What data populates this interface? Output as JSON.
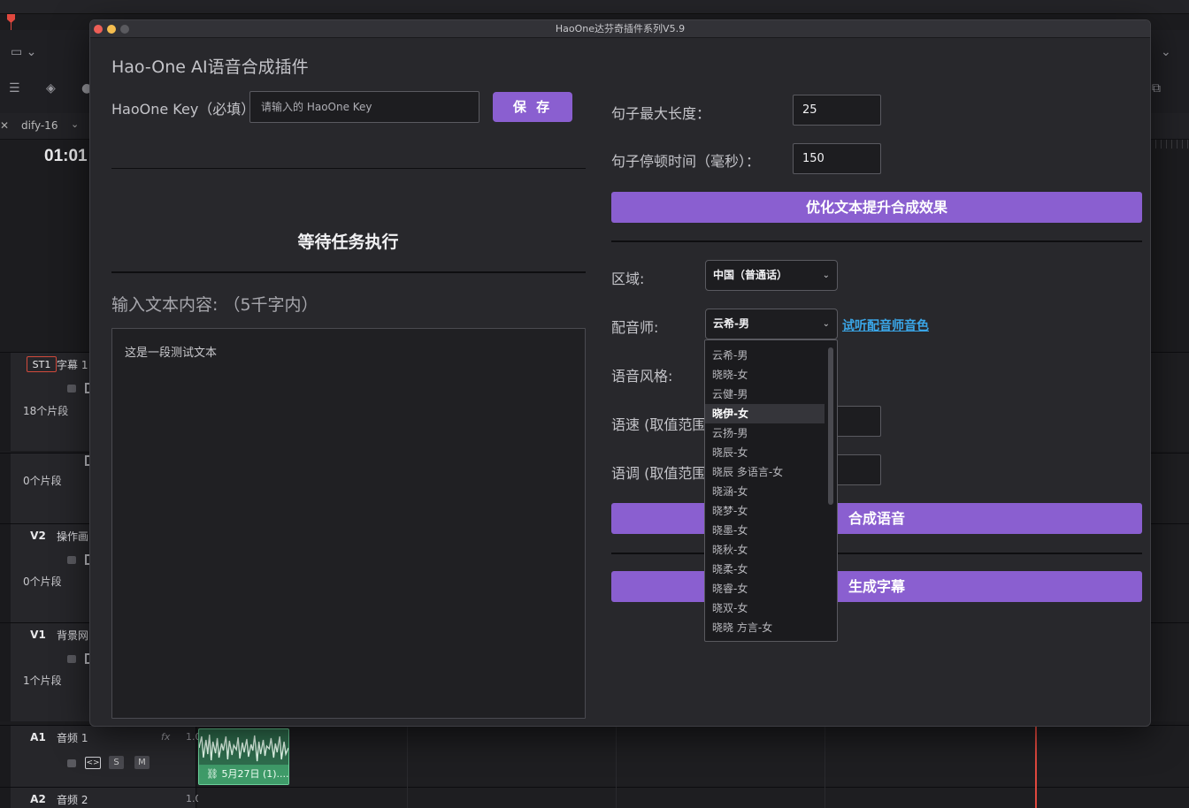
{
  "background": {
    "timeline_name": "dify-16",
    "timecode": "01:01",
    "tracks": [
      {
        "tag": "ST1",
        "name": "字幕 1",
        "count": "18个片段"
      },
      {
        "count": "0个片段"
      },
      {
        "tag": "V2",
        "name": "操作画",
        "count": "0个片段"
      },
      {
        "tag": "V1",
        "name": "背景网",
        "count": "1个片段"
      },
      {
        "tag": "A1",
        "name": "音频 1",
        "fx": "fx",
        "gain": "1.0",
        "solo": "S",
        "mute": "M"
      },
      {
        "tag": "A2",
        "name": "音频 2",
        "gain": "1.0"
      }
    ],
    "clip_label": "5月27日 (1)...."
  },
  "window": {
    "title": "HaoOne达芬奇插件系列V5.9"
  },
  "plugin": {
    "app_title": "Hao-One AI语音合成插件",
    "key_label": "HaoOne Key（必填）",
    "key_placeholder": "请输入的 HaoOne Key",
    "save_label": "保 存",
    "status": "等待任务执行",
    "input_label": "输入文本内容: （5千字内）",
    "input_text": "这是一段测试文本",
    "max_len_label": "句子最大长度：",
    "max_len_value": "25",
    "pause_label": "句子停顿时间（毫秒）：",
    "pause_value": "150",
    "optimize_label": "优化文本提升合成效果",
    "region_label": "区域:",
    "region_value": "中国（普通话）",
    "voice_label": "配音师:",
    "voice_value": "云希-男",
    "preview_link": "试听配音师音色",
    "style_label": "语音风格:",
    "speed_label": "语速 (取值范围",
    "pitch_label": "语调 (取值范围",
    "synth_label": "合成语音",
    "subtitle_label": "生成字幕",
    "voice_options": [
      "云希-男",
      "晓晓-女",
      "云健-男",
      "晓伊-女",
      "云扬-男",
      "晓辰-女",
      "晓辰 多语言-女",
      "晓涵-女",
      "晓梦-女",
      "晓墨-女",
      "晓秋-女",
      "晓柔-女",
      "晓睿-女",
      "晓双-女",
      "晓晓 方言-女"
    ],
    "voice_highlighted_index": 3,
    "accent_color": "#8a5fd0",
    "link_color": "#3aa6e8"
  }
}
